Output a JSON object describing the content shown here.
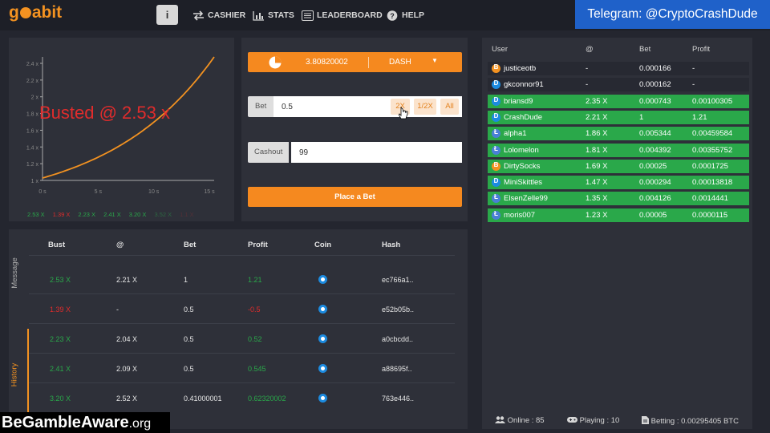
{
  "nav": {
    "logo": "goabit",
    "info": "i",
    "items": [
      {
        "label": "CASHIER",
        "icon": "transfer-icon"
      },
      {
        "label": "STATS",
        "icon": "bar-chart-icon"
      },
      {
        "label": "LEADERBOARD",
        "icon": "list-icon"
      },
      {
        "label": "HELP",
        "icon": "help-icon"
      }
    ],
    "telegram": "Telegram: @CryptoCrashDude"
  },
  "graph": {
    "busted_text": "Busted @ 2.53 x",
    "y_ticks": [
      "1 x",
      "1.2 x",
      "1.4 x",
      "1.6 x",
      "1.8 x",
      "2 x",
      "2.2 x",
      "2.4 x"
    ],
    "x_ticks": [
      "0 s",
      "5 s",
      "10 s",
      "15 s"
    ],
    "recent_busts": [
      {
        "value": "2.53 X",
        "color": "#2aa84a"
      },
      {
        "value": "1.39 X",
        "color": "#e02c2c"
      },
      {
        "value": "2.23 X",
        "color": "#2aa84a"
      },
      {
        "value": "2.41 X",
        "color": "#2aa84a"
      },
      {
        "value": "3.20 X",
        "color": "#2aa84a"
      },
      {
        "value": "3.52 X",
        "color": "#2aa84a"
      },
      {
        "value": "1.1 X",
        "color": "#e02c2c"
      }
    ],
    "line_color": "#f39221"
  },
  "bet": {
    "balance": "3.80820002",
    "currency": "DASH",
    "bet_label": "Bet",
    "bet_value": "0.5",
    "double_label": "2X",
    "half_label": "1/2X",
    "all_label": "All",
    "cashout_label": "Cashout",
    "cashout_value": "99",
    "place_bet_label": "Place a Bet"
  },
  "history": {
    "tabs": {
      "message": "Message",
      "history": "History"
    },
    "headers": [
      "Bust",
      "@",
      "Bet",
      "Profit",
      "Coin",
      "Hash"
    ],
    "rows": [
      {
        "bust": "2.53 X",
        "at": "2.21 X",
        "bet": "1",
        "profit": "1.21",
        "win": true,
        "hash": "ec766a1.."
      },
      {
        "bust": "1.39 X",
        "at": "-",
        "bet": "0.5",
        "profit": "-0.5",
        "win": false,
        "hash": "e52b05b.."
      },
      {
        "bust": "2.23 X",
        "at": "2.04 X",
        "bet": "0.5",
        "profit": "0.52",
        "win": true,
        "hash": "a0cbcdd.."
      },
      {
        "bust": "2.41 X",
        "at": "2.09 X",
        "bet": "0.5",
        "profit": "0.545",
        "win": true,
        "hash": "a88695f.."
      },
      {
        "bust": "3.20 X",
        "at": "2.52 X",
        "bet": "0.41000001",
        "profit": "0.62320002",
        "win": true,
        "hash": "763e446.."
      }
    ],
    "colors": {
      "win": "#2aa84a",
      "loss": "#e02c2c"
    }
  },
  "players": {
    "headers": [
      "User",
      "@",
      "Bet",
      "Profit"
    ],
    "rows": [
      {
        "coin": "B",
        "coin_color": "#f39221",
        "user": "justiceotb",
        "at": "-",
        "bet": "0.000166",
        "profit": "-",
        "win": false
      },
      {
        "coin": "D",
        "coin_color": "#1c8be0",
        "user": "gkconnor91",
        "at": "-",
        "bet": "0.000162",
        "profit": "-",
        "win": false
      },
      {
        "coin": "D",
        "coin_color": "#1c8be0",
        "user": "briansd9",
        "at": "2.35 X",
        "bet": "0.000743",
        "profit": "0.00100305",
        "win": true
      },
      {
        "coin": "D",
        "coin_color": "#1c8be0",
        "user": "CrashDude",
        "at": "2.21 X",
        "bet": "1",
        "profit": "1.21",
        "win": true
      },
      {
        "coin": "Ł",
        "coin_color": "#4a7fd6",
        "user": "alpha1",
        "at": "1.86 X",
        "bet": "0.005344",
        "profit": "0.00459584",
        "win": true
      },
      {
        "coin": "Ł",
        "coin_color": "#4a7fd6",
        "user": "Lolomelon",
        "at": "1.81 X",
        "bet": "0.004392",
        "profit": "0.00355752",
        "win": true
      },
      {
        "coin": "B",
        "coin_color": "#f39221",
        "user": "DirtySocks",
        "at": "1.69 X",
        "bet": "0.00025",
        "profit": "0.0001725",
        "win": true
      },
      {
        "coin": "D",
        "coin_color": "#1c8be0",
        "user": "MiniSkittles",
        "at": "1.47 X",
        "bet": "0.000294",
        "profit": "0.00013818",
        "win": true
      },
      {
        "coin": "Ł",
        "coin_color": "#4a7fd6",
        "user": "ElsenZelle99",
        "at": "1.35 X",
        "bet": "0.004126",
        "profit": "0.0014441",
        "win": true
      },
      {
        "coin": "Ł",
        "coin_color": "#4a7fd6",
        "user": "moris007",
        "at": "1.23 X",
        "bet": "0.00005",
        "profit": "0.0000115",
        "win": true
      }
    ],
    "footer": {
      "online": "Online : 85",
      "playing": "Playing : 10",
      "betting": "Betting : 0.00295405 BTC"
    }
  },
  "overlay": {
    "begamble": "BeGambleAware.org"
  }
}
